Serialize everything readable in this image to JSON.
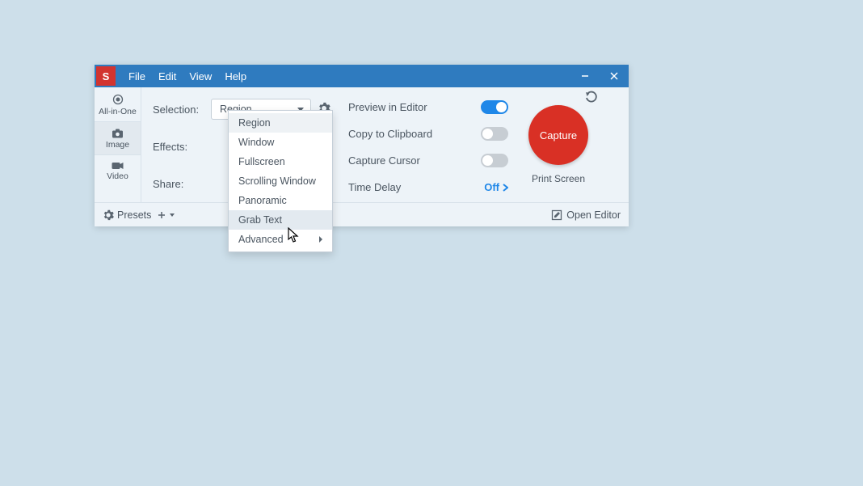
{
  "app": {
    "icon_letter": "S",
    "menus": [
      "File",
      "Edit",
      "View",
      "Help"
    ]
  },
  "tabs": {
    "all_in_one": "All-in-One",
    "image": "Image",
    "video": "Video"
  },
  "config": {
    "selection_label": "Selection:",
    "selection_value": "Region",
    "effects_label": "Effects:",
    "share_label": "Share:"
  },
  "selection_menu": {
    "items": [
      "Region",
      "Window",
      "Fullscreen",
      "Scrolling Window",
      "Panoramic",
      "Grab Text",
      "Advanced"
    ],
    "selected_index": 0,
    "hover_index": 5,
    "submenu_index": 6
  },
  "options": {
    "preview": {
      "label": "Preview in Editor",
      "on": true
    },
    "clipboard": {
      "label": "Copy to Clipboard",
      "on": false
    },
    "cursor": {
      "label": "Capture Cursor",
      "on": false
    },
    "delay": {
      "label": "Time Delay",
      "value": "Off"
    }
  },
  "capture": {
    "button": "Capture",
    "hotkey": "Print Screen"
  },
  "footer": {
    "presets": "Presets",
    "open_editor": "Open Editor"
  }
}
